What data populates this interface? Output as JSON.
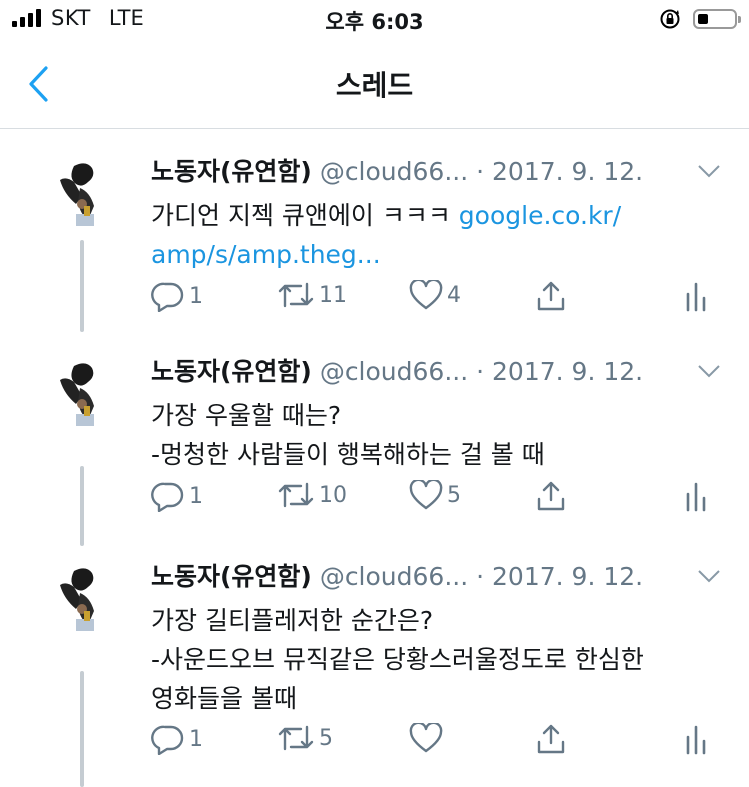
{
  "status_bar": {
    "carrier": "SKT",
    "network": "LTE",
    "time": "오후 6:03",
    "battery_level": 0.3
  },
  "nav": {
    "title": "스레드",
    "back_icon": "chevron-left-icon"
  },
  "colors": {
    "link": "#1b95e0",
    "secondary_text": "#657786",
    "thread_line": "#c5ccd2",
    "back_accent": "#1da1f2"
  },
  "tweets": [
    {
      "name": "노동자(유연함)",
      "handle": "@cloud66...",
      "date": "· 2017. 9. 12.",
      "body_line1_text": "가디언 지젝 큐앤에이 ㅋㅋㅋ ",
      "body_line1_link": "google.co.kr/",
      "body_line2_link": "amp/s/amp.theg...",
      "replies": "1",
      "retweets": "11",
      "likes": "4"
    },
    {
      "name": "노동자(유연함)",
      "handle": "@cloud66...",
      "date": "· 2017. 9. 12.",
      "body_line1": "가장 우울할 때는?",
      "body_line2": "-멍청한 사람들이 행복해하는 걸 볼 때",
      "replies": "1",
      "retweets": "10",
      "likes": "5"
    },
    {
      "name": "노동자(유연함)",
      "handle": "@cloud66...",
      "date": "· 2017. 9. 12.",
      "body_line1": "가장 길티플레저한 순간은?",
      "body_line2": "-사운드오브 뮤직같은 당황스러울정도로 한심한",
      "body_line3": "영화들을 볼때",
      "replies": "1",
      "retweets": "5",
      "likes": ""
    }
  ]
}
